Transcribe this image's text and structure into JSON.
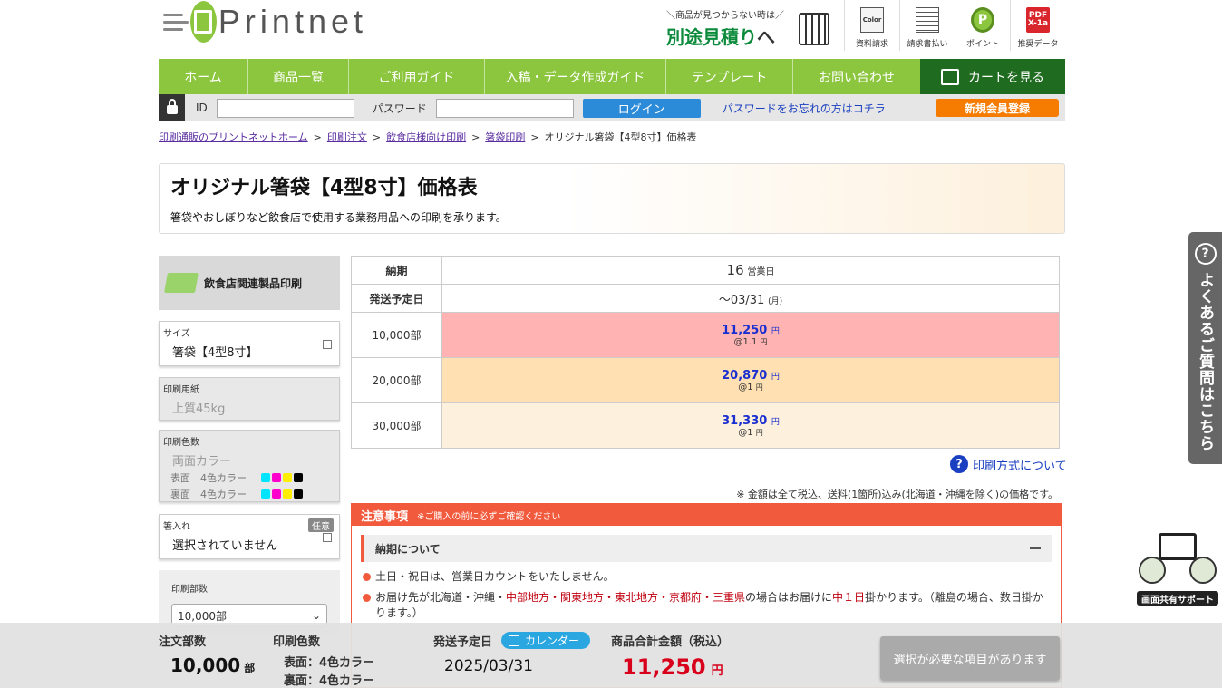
{
  "header": {
    "logo_text": "Printnet",
    "estimate_small": "＼商品が見つからない時は／",
    "estimate_big": "別途見積り",
    "estimate_suffix": "へ",
    "utils": [
      {
        "label": "資料請求",
        "icon": "brochure-icon",
        "glyph": "Color"
      },
      {
        "label": "請求書払い",
        "icon": "invoice-icon",
        "glyph": "¥"
      },
      {
        "label": "ポイント",
        "icon": "point-icon",
        "glyph": "P"
      },
      {
        "label": "推奨データ",
        "icon": "pdf-icon",
        "glyph": "PDF X-1a"
      }
    ]
  },
  "nav": {
    "items": [
      "ホーム",
      "商品一覧",
      "ご利用ガイド",
      "入稿・データ作成ガイド",
      "テンプレート",
      "お問い合わせ"
    ],
    "cart": "カートを見る"
  },
  "login": {
    "id_label": "ID",
    "password_label": "パスワード",
    "login_button": "ログイン",
    "forgot_link": "パスワードをお忘れの方はコチラ",
    "register_button": "新規会員登録"
  },
  "breadcrumb": {
    "items": [
      "印刷通販のプリントネットホーム",
      "印刷注文",
      "飲食店様向け印刷",
      "箸袋印刷"
    ],
    "current": "オリジナル箸袋【4型8寸】価格表",
    "separator": ">"
  },
  "title": {
    "heading": "オリジナル箸袋【4型8寸】価格表",
    "description": "箸袋やおしぼりなど飲食店で使用する業務用品への印刷を承ります。"
  },
  "sidebar": {
    "category": "飲食店関連製品印刷",
    "size_label": "サイズ",
    "size_value": "箸袋【4型8寸】",
    "paper_label": "印刷用紙",
    "paper_value": "上質45kg",
    "color_label": "印刷色数",
    "color_value": "両面カラー",
    "front_label": "表面",
    "front_value": "4色カラー",
    "back_label": "裏面",
    "back_value": "4色カラー",
    "ink_colors": [
      "#00e5ff",
      "#ff00cc",
      "#ffee00",
      "#000000"
    ],
    "insert_label": "箸入れ",
    "insert_badge": "任意",
    "insert_value": "選択されていません",
    "qty_label": "印刷部数",
    "qty_value": "10,000部"
  },
  "price_table": {
    "delivery_label": "納期",
    "delivery_days": "16",
    "delivery_unit": "営業日",
    "ship_label": "発送予定日",
    "ship_date": "〜03/31",
    "ship_day": "(月)",
    "rows": [
      {
        "qty": "10,000部",
        "price": "11,250",
        "yen": "円",
        "unit": "@1.1",
        "bg": "#ffb3b3"
      },
      {
        "qty": "20,000部",
        "price": "20,870",
        "yen": "円",
        "unit": "@1",
        "bg": "#ffe0b3"
      },
      {
        "qty": "30,000部",
        "price": "31,330",
        "yen": "円",
        "unit": "@1",
        "bg": "#fdf0dc"
      }
    ],
    "unit_yen": "円"
  },
  "about_link": "印刷方式について",
  "note": "※ 金額は全て税込、送料(1箇所)込み(北海道・沖縄を除く)の価格です。",
  "caution": {
    "title": "注意事項",
    "subtitle": "※ご購入の前に必ずご確認ください",
    "section_title": "納期について",
    "bullet1": "土日・祝日は、営業日カウントをいたしません。",
    "bullet2_pre": "お届け先が北海道・沖縄・",
    "bullet2_red1": "中部地方・関東地方・東北地方・京都府・三重県",
    "bullet2_mid": "の場合はお届けに",
    "bullet2_red2": "中１日",
    "bullet2_post": "掛かります。（離島の場合、数日掛かります。）"
  },
  "faq": "よくあるご質問はこちら",
  "share": "画面共有サポート",
  "bottom": {
    "order_qty_label": "注文部数",
    "order_qty": "10,000",
    "order_qty_unit": "部",
    "colors_label": "印刷色数",
    "front": "表面：4色カラー",
    "back": "裏面：4色カラー",
    "ship_label": "発送予定日",
    "calendar": "カレンダー",
    "ship_date": "2025/03/31",
    "total_label": "商品合計金額（税込）",
    "total": "11,250",
    "total_unit": "円",
    "submit": "選択が必要な項目があります"
  },
  "colors": {
    "accent_green": "#8cc63f",
    "cart_green": "#1f6b1f",
    "orange": "#f57c00",
    "caution_red": "#f15a3c",
    "price_blue": "#1a2fd0",
    "total_red": "#d8001a"
  }
}
